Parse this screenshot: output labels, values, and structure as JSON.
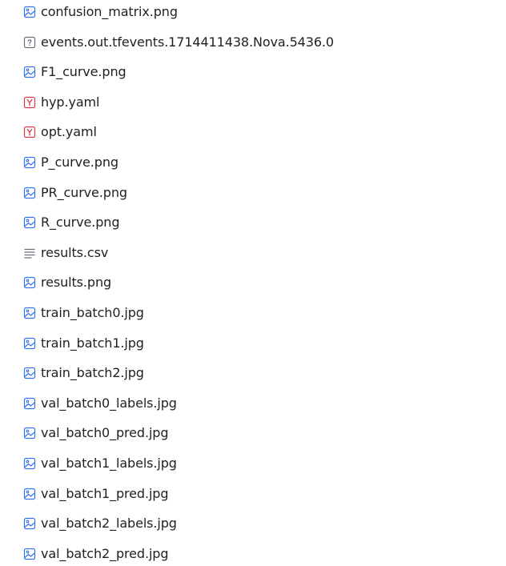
{
  "colors": {
    "image_icon": "#3574f0",
    "unknown_icon": "#6c707e",
    "yaml_icon": "#db3b4b",
    "text_icon": "#6c707e",
    "text": "#1f1f1f"
  },
  "files": [
    {
      "name": "confusion_matrix.png",
      "icon": "image-file-icon"
    },
    {
      "name": "events.out.tfevents.1714411438.Nova.5436.0",
      "icon": "unknown-file-icon"
    },
    {
      "name": "F1_curve.png",
      "icon": "image-file-icon"
    },
    {
      "name": "hyp.yaml",
      "icon": "yaml-file-icon"
    },
    {
      "name": "opt.yaml",
      "icon": "yaml-file-icon"
    },
    {
      "name": "P_curve.png",
      "icon": "image-file-icon"
    },
    {
      "name": "PR_curve.png",
      "icon": "image-file-icon"
    },
    {
      "name": "R_curve.png",
      "icon": "image-file-icon"
    },
    {
      "name": "results.csv",
      "icon": "text-file-icon"
    },
    {
      "name": "results.png",
      "icon": "image-file-icon"
    },
    {
      "name": "train_batch0.jpg",
      "icon": "image-file-icon"
    },
    {
      "name": "train_batch1.jpg",
      "icon": "image-file-icon"
    },
    {
      "name": "train_batch2.jpg",
      "icon": "image-file-icon"
    },
    {
      "name": "val_batch0_labels.jpg",
      "icon": "image-file-icon"
    },
    {
      "name": "val_batch0_pred.jpg",
      "icon": "image-file-icon"
    },
    {
      "name": "val_batch1_labels.jpg",
      "icon": "image-file-icon"
    },
    {
      "name": "val_batch1_pred.jpg",
      "icon": "image-file-icon"
    },
    {
      "name": "val_batch2_labels.jpg",
      "icon": "image-file-icon"
    },
    {
      "name": "val_batch2_pred.jpg",
      "icon": "image-file-icon"
    }
  ]
}
